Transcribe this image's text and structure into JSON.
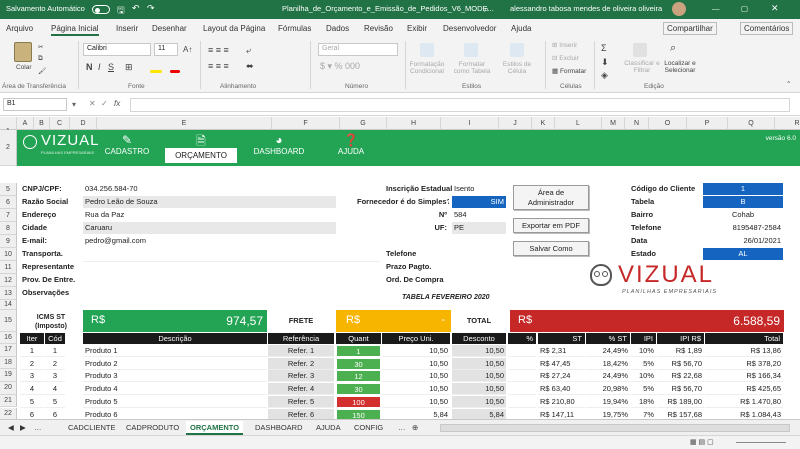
{
  "titlebar": {
    "autosave": "Salvamento Automático",
    "filename": "Planilha_de_Orçamento_e_Emissão_de_Pedidos_V6_MODE...",
    "user": "alessandro tabosa mendes de oliveira oliveira"
  },
  "menu": [
    "Arquivo",
    "Página Inicial",
    "Inserir",
    "Desenhar",
    "Layout da Página",
    "Fórmulas",
    "Dados",
    "Revisão",
    "Exibir",
    "Desenvolvedor",
    "Ajuda"
  ],
  "menu_right": {
    "share": "Compartilhar",
    "comments": "Comentários"
  },
  "ribbon": {
    "paste": "Colar",
    "clipboard": "Área de Transferência",
    "font_name": "Calibri",
    "font_size": "11",
    "font_group": "Fonte",
    "align_group": "Alinhamento",
    "number_format": "Geral",
    "number_group": "Número",
    "cond_format": "Formatação Condicional",
    "format_table": "Formatar como Tabela",
    "cell_styles": "Estilos de Célula",
    "styles_group": "Estilos",
    "insert": "Inserir",
    "delete": "Excluir",
    "format": "Formatar",
    "cells_group": "Células",
    "sort": "Classificar e Filtrar",
    "find": "Localizar e Selecionar",
    "edit_group": "Edição"
  },
  "formula_bar": {
    "namebox": "B1",
    "fx": "fx"
  },
  "columns": [
    "A",
    "B",
    "C",
    "D",
    "E",
    "F",
    "G",
    "H",
    "I",
    "J",
    "K",
    "L",
    "M",
    "N",
    "O",
    "P",
    "Q",
    "R"
  ],
  "banner": {
    "brand": "VIZUAL",
    "brand_sub": "PLANILHAS EMPRESARIAIS",
    "nav": [
      "CADASTRO",
      "ORÇAMENTO",
      "DASHBOARD",
      "AJUDA"
    ],
    "version": "versão 6.0"
  },
  "client": {
    "cnpj_label": "CNPJ/CPF:",
    "cnpj": "034.256.584-70",
    "razao_label": "Razão Social",
    "razao": "Pedro Leão de Souza",
    "endereco_label": "Endereço",
    "endereco": "Rua da Paz",
    "cidade_label": "Cidade",
    "cidade": "Caruaru",
    "email_label": "E-mail:",
    "email": "pedro@gmail.com",
    "transporta_label": "Transporta.",
    "representante_label": "Representante",
    "prov_label": "Prov. De Entre.",
    "obs_label": "Observações",
    "ie_label": "Inscrição Estadual",
    "ie": "Isento",
    "simples_label": "Fornecedor é do Simples?",
    "simples": "SIM",
    "num_label": "Nº",
    "num": "584",
    "uf_label": "UF:",
    "uf": "PE",
    "telefone_label": "Telefone",
    "prazo_label": "Prazo Pagto.",
    "ord_label": "Ord. De Compra",
    "tabela_titulo": "TABELA FEVEREIRO 2020"
  },
  "buttons": {
    "admin": "Área de Administrador",
    "pdf": "Exportar em PDF",
    "save": "Salvar Como"
  },
  "info": {
    "codigo_label": "Código do Cliente",
    "codigo": "1",
    "tabela_label": "Tabela",
    "tabela": "B",
    "bairro_label": "Bairro",
    "bairro": "Cohab",
    "telefone_label": "Telefone",
    "telefone": "8195487-2584",
    "data_label": "Data",
    "data": "26/01/2021",
    "estado_label": "Estado",
    "estado": "AL"
  },
  "totals": {
    "icms_label": "ICMS ST (Imposto)",
    "icms_currency": "R$",
    "icms_value": "974,57",
    "frete_label": "FRETE",
    "frete_currency": "R$",
    "frete_value": "-",
    "total_label": "TOTAL",
    "total_currency": "R$",
    "total_value": "6.588,59"
  },
  "table": {
    "headers": [
      "Iter",
      "Cód",
      "Descrição",
      "Referência",
      "Quant",
      "Preço Uni.",
      "Desconto",
      "%",
      "ST",
      "% ST",
      "IPI",
      "IPI R$",
      "Total"
    ],
    "rows": [
      {
        "r": "17",
        "item": "1",
        "cod": "1",
        "desc": "Produto 1",
        "ref": "Refer. 1",
        "qty": "1",
        "qtyColor": "#4caf50",
        "price": "10,50",
        "disc": "10,50",
        "st": "R$    2,31",
        "pst": "24,49%",
        "ipi": "10%",
        "ipir": "R$     1,89",
        "total": "R$               13,86"
      },
      {
        "r": "18",
        "item": "2",
        "cod": "2",
        "desc": "Produto 2",
        "ref": "Refer. 2",
        "qty": "30",
        "qtyColor": "#4caf50",
        "price": "10,50",
        "disc": "10,50",
        "st": "R$   47,45",
        "pst": "18,42%",
        "ipi": "5%",
        "ipir": "R$   56,70",
        "total": "R$             378,20"
      },
      {
        "r": "19",
        "item": "3",
        "cod": "3",
        "desc": "Produto 3",
        "ref": "Refer. 3",
        "qty": "12",
        "qtyColor": "#4caf50",
        "price": "10,50",
        "disc": "10,50",
        "st": "R$   27,24",
        "pst": "24,49%",
        "ipi": "10%",
        "ipir": "R$   22,68",
        "total": "R$             166,34"
      },
      {
        "r": "20",
        "item": "4",
        "cod": "4",
        "desc": "Produto 4",
        "ref": "Refer. 4",
        "qty": "30",
        "qtyColor": "#4caf50",
        "price": "10,50",
        "disc": "10,50",
        "st": "R$   63,40",
        "pst": "20,98%",
        "ipi": "5%",
        "ipir": "R$   56,70",
        "total": "R$             425,65"
      },
      {
        "r": "21",
        "item": "5",
        "cod": "5",
        "desc": "Produto 5",
        "ref": "Refer. 5",
        "qty": "100",
        "qtyColor": "#d32f2f",
        "price": "10,50",
        "disc": "10,50",
        "st": "R$  210,80",
        "pst": "19,94%",
        "ipi": "18%",
        "ipir": "R$ 189,00",
        "total": "R$          1.470,80"
      },
      {
        "r": "22",
        "item": "6",
        "cod": "6",
        "desc": "Produto 6",
        "ref": "Refer. 6",
        "qty": "150",
        "qtyColor": "#4caf50",
        "price": "5,84",
        "disc": "5,84",
        "st": "R$  147,11",
        "pst": "19,75%",
        "ipi": "7%",
        "ipir": "R$ 157,68",
        "total": "R$          1.084,43"
      }
    ]
  },
  "tabs": [
    "CADCLIENTE",
    "CADPRODUTO",
    "ORÇAMENTO",
    "DASHBOARD",
    "AJUDA",
    "CONFIG"
  ],
  "logo": {
    "text": "VIZUAL",
    "sub": "PLANILHAS EMPRESARIAIS"
  }
}
